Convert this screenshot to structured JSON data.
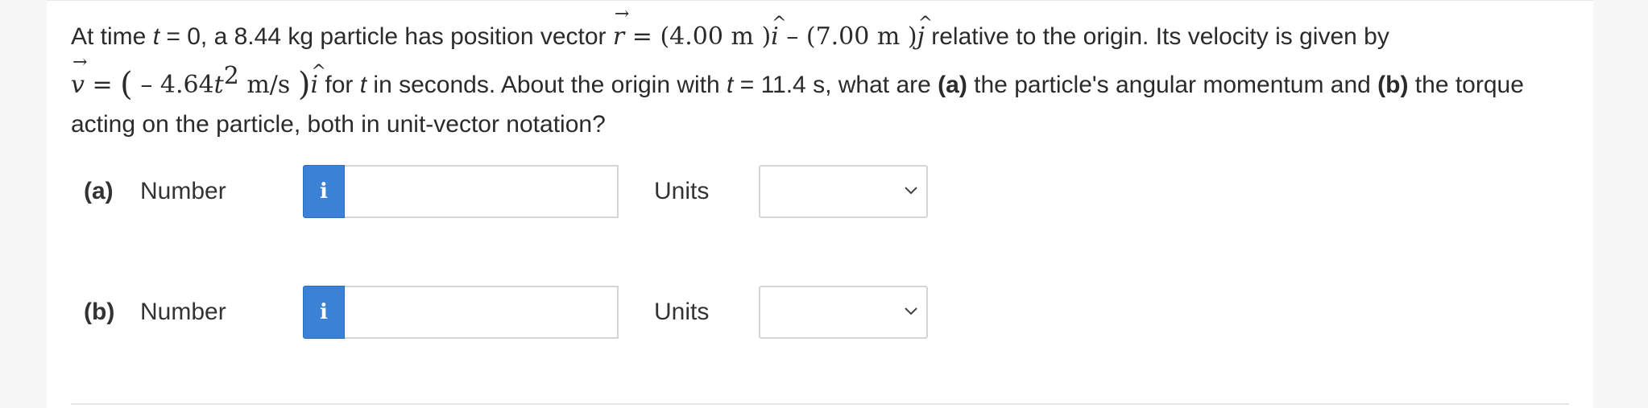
{
  "question": {
    "s1": "At time ",
    "t_var": "t",
    "s2": " = 0, a 8.44 kg particle has position vector ",
    "r_var": "r",
    "s3": " = ",
    "r_x": "(4.00  m )",
    "i_hat": "i",
    "minus": " – ",
    "r_y": "(7.00  m )",
    "j_hat": "j",
    "s4": " relative to the origin. Its velocity is given by",
    "v_var": "v",
    "eq": " = ",
    "open_paren": "(",
    "v_coef": " – 4.64",
    "v_t": "t",
    "v_exp": "2",
    "v_unit": "  m/s ",
    "close_paren": ")",
    "i_hat2": "i",
    "s5": " for ",
    "t_var2": "t",
    "s6": " in seconds. About the origin with ",
    "t_var3": "t",
    "s7": " = 11.4 s, what are ",
    "a_tag": "(a)",
    "s8": " the particle's angular momentum and ",
    "b_tag": "(b)",
    "s9": " the torque acting on the particle, both in unit-vector notation?",
    "arrow_glyph": "⃗",
    "hat_glyph": "^"
  },
  "parts": [
    {
      "label": "(a)",
      "number_label": "Number",
      "info_icon": "i",
      "number_value": "",
      "units_label": "Units",
      "units_selected": ""
    },
    {
      "label": "(b)",
      "number_label": "Number",
      "info_icon": "i",
      "number_value": "",
      "units_label": "Units",
      "units_selected": ""
    }
  ],
  "colors": {
    "info_button": "#3b82d6",
    "page_background": "#f7f7f7",
    "card_background": "#ffffff"
  }
}
